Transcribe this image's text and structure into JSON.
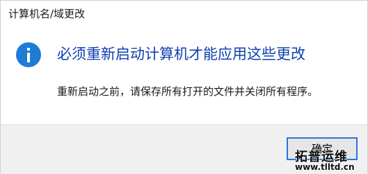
{
  "window": {
    "title": "计算机名/域更改"
  },
  "dialog": {
    "icon": "info-icon",
    "heading": "必须重新启动计算机才能应用这些更改",
    "message": "重新启动之前，请保存所有打开的文件并关闭所有程序。"
  },
  "buttons": {
    "ok_label": "确定"
  },
  "watermark": {
    "line1": "拓普运维",
    "line2": "www.tlltd.cn"
  },
  "colors": {
    "accent": "#1e7bd6",
    "heading": "#0f3fb0",
    "footer_bg": "#f0f0f0"
  }
}
